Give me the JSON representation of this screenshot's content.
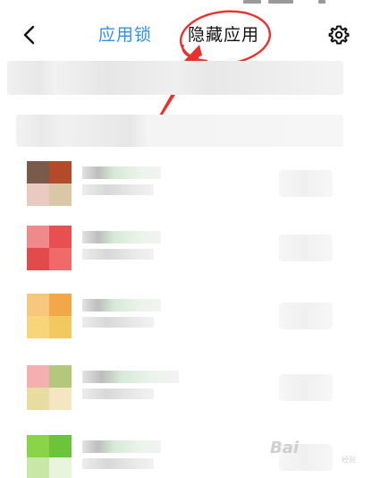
{
  "header": {
    "tabs": [
      {
        "label": "应用锁",
        "active": true
      },
      {
        "label": "隐藏应用",
        "active": false
      }
    ]
  },
  "colors": {
    "accent": "#2f8ff0",
    "annotation": "#e8312a",
    "text_primary": "#111111"
  },
  "icons": {
    "back": "chevron-left-icon",
    "settings": "gear-icon"
  },
  "apps": [
    {
      "icon_palette": [
        "#7a5a4a",
        "#b34a2a",
        "#e9c9c0",
        "#d9c7a6"
      ]
    },
    {
      "icon_palette": [
        "#f08a8a",
        "#e85050",
        "#e24b4b",
        "#f06a6a"
      ]
    },
    {
      "icon_palette": [
        "#f6c77c",
        "#f2a84a",
        "#f7d67a",
        "#f2c860"
      ]
    },
    {
      "icon_palette": [
        "#f4b0b0",
        "#b4c77a",
        "#e8dca0",
        "#f3e6c0"
      ]
    },
    {
      "icon_palette": [
        "#8ad44a",
        "#6cc43a",
        "#c8e8a8",
        "#e8f4dc"
      ]
    }
  ],
  "watermark": {
    "logo": "Bai",
    "sub": "经验"
  }
}
